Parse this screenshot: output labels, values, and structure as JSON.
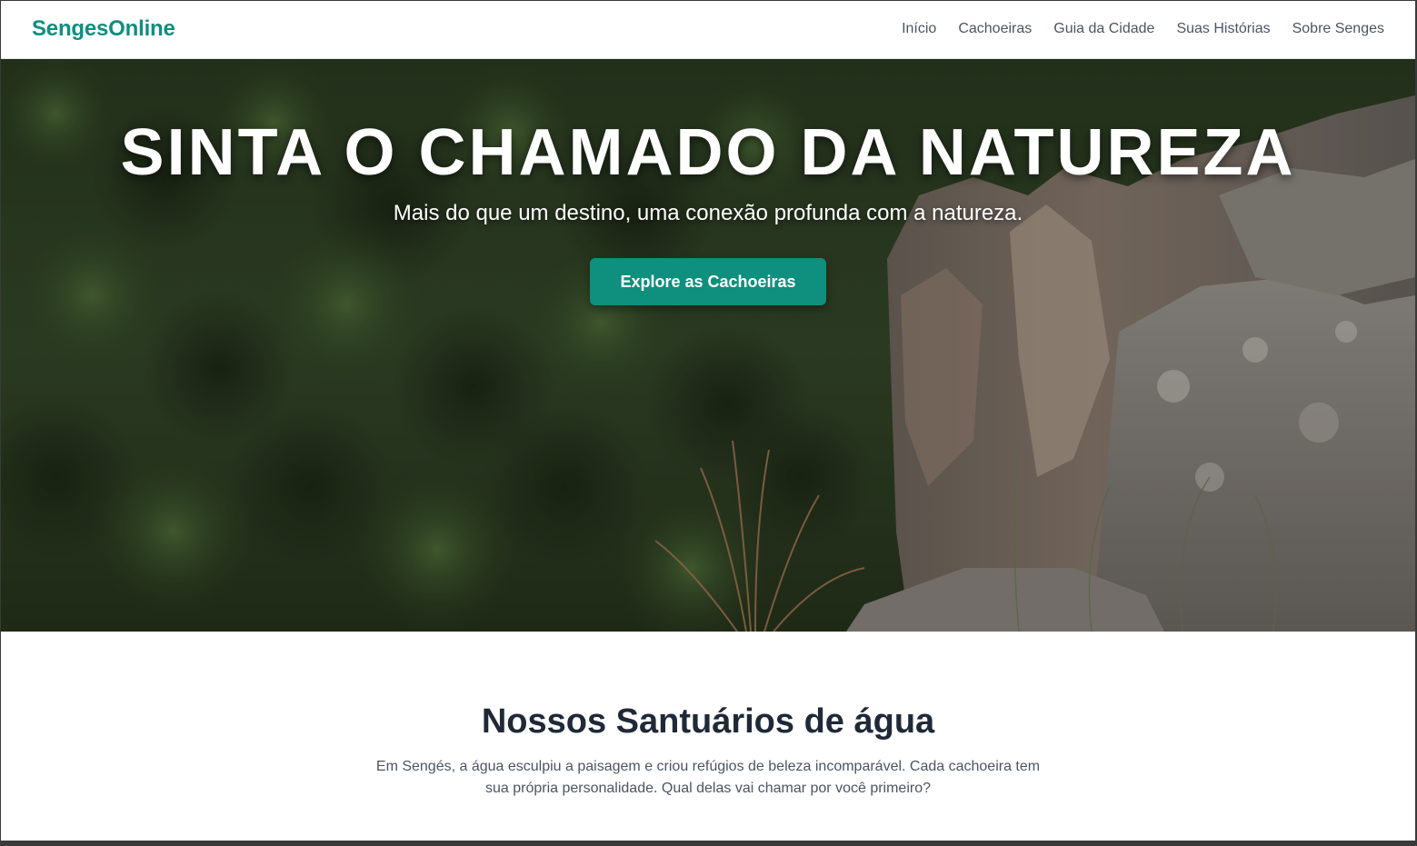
{
  "brand": {
    "name": "SengesOnline",
    "color": "#0f8f7e"
  },
  "nav": {
    "items": [
      {
        "label": "Início"
      },
      {
        "label": "Cachoeiras"
      },
      {
        "label": "Guia da Cidade"
      },
      {
        "label": "Suas Histórias"
      },
      {
        "label": "Sobre Senges"
      }
    ]
  },
  "hero": {
    "title": "SINTA O CHAMADO DA NATUREZA",
    "subtitle": "Mais do que um destino, uma conexão profunda com a natureza.",
    "cta_label": "Explore as Cachoeiras",
    "cta_color": "#0f8f7e"
  },
  "section": {
    "title": "Nossos Santuários de água",
    "text": "Em Sengés, a água esculpiu a paisagem e criou refúgios de beleza incomparável. Cada cachoeira tem sua própria personalidade. Qual delas vai chamar por você primeiro?"
  }
}
